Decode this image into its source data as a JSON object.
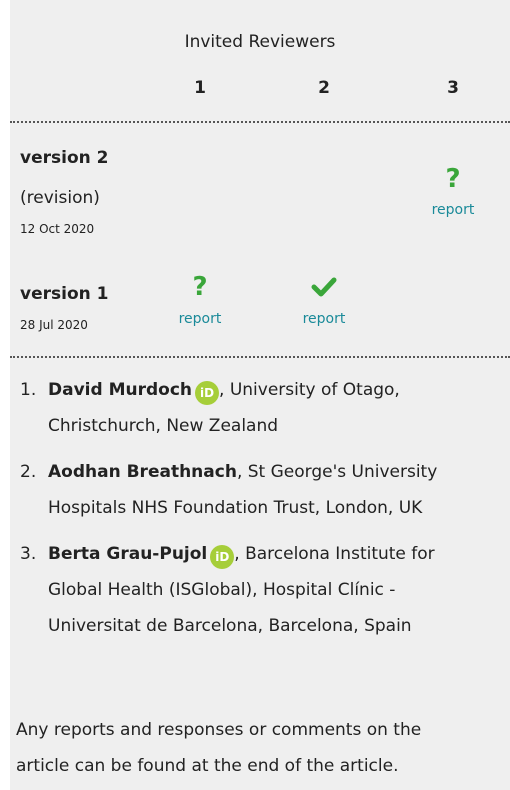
{
  "header": {
    "title": "Invited Reviewers",
    "columns": [
      "1",
      "2",
      "3"
    ]
  },
  "versions": [
    {
      "label": "version 2",
      "note": "(revision)",
      "date": "12 Oct 2020",
      "reports": {
        "3": {
          "status": "question-mark",
          "link": "report"
        }
      }
    },
    {
      "label": "version 1",
      "date": "28 Jul 2020",
      "reports": {
        "1": {
          "status": "question-mark",
          "link": "report"
        },
        "2": {
          "status": "check-mark",
          "link": "report"
        }
      }
    }
  ],
  "reviewers": [
    {
      "num": "1.",
      "name": "David Murdoch",
      "orcid_badge": "iD",
      "affiliation_line1": ", University of Otago,",
      "affiliation_line2": "Christchurch, New Zealand"
    },
    {
      "num": "2.",
      "name": "Aodhan Breathnach",
      "affiliation_line1": ", St George's University",
      "affiliation_line2": "Hospitals NHS Foundation Trust, London, UK"
    },
    {
      "num": "3.",
      "name": "Berta Grau-Pujol",
      "orcid_badge": "iD",
      "affiliation_line1": ", Barcelona Institute for",
      "affiliation_line2": "Global Health (ISGlobal), Hospital Clínic -",
      "affiliation_line3": "Universitat de Barcelona, Barcelona, Spain"
    }
  ],
  "footer": {
    "line1": "Any reports and responses or comments on the",
    "line2": "article can be found at the end of the article."
  },
  "colors": {
    "panel_bg": "#efefef",
    "status_green": "#3aa63a",
    "link": "#1a8a99",
    "orcid": "#a6ce39"
  }
}
